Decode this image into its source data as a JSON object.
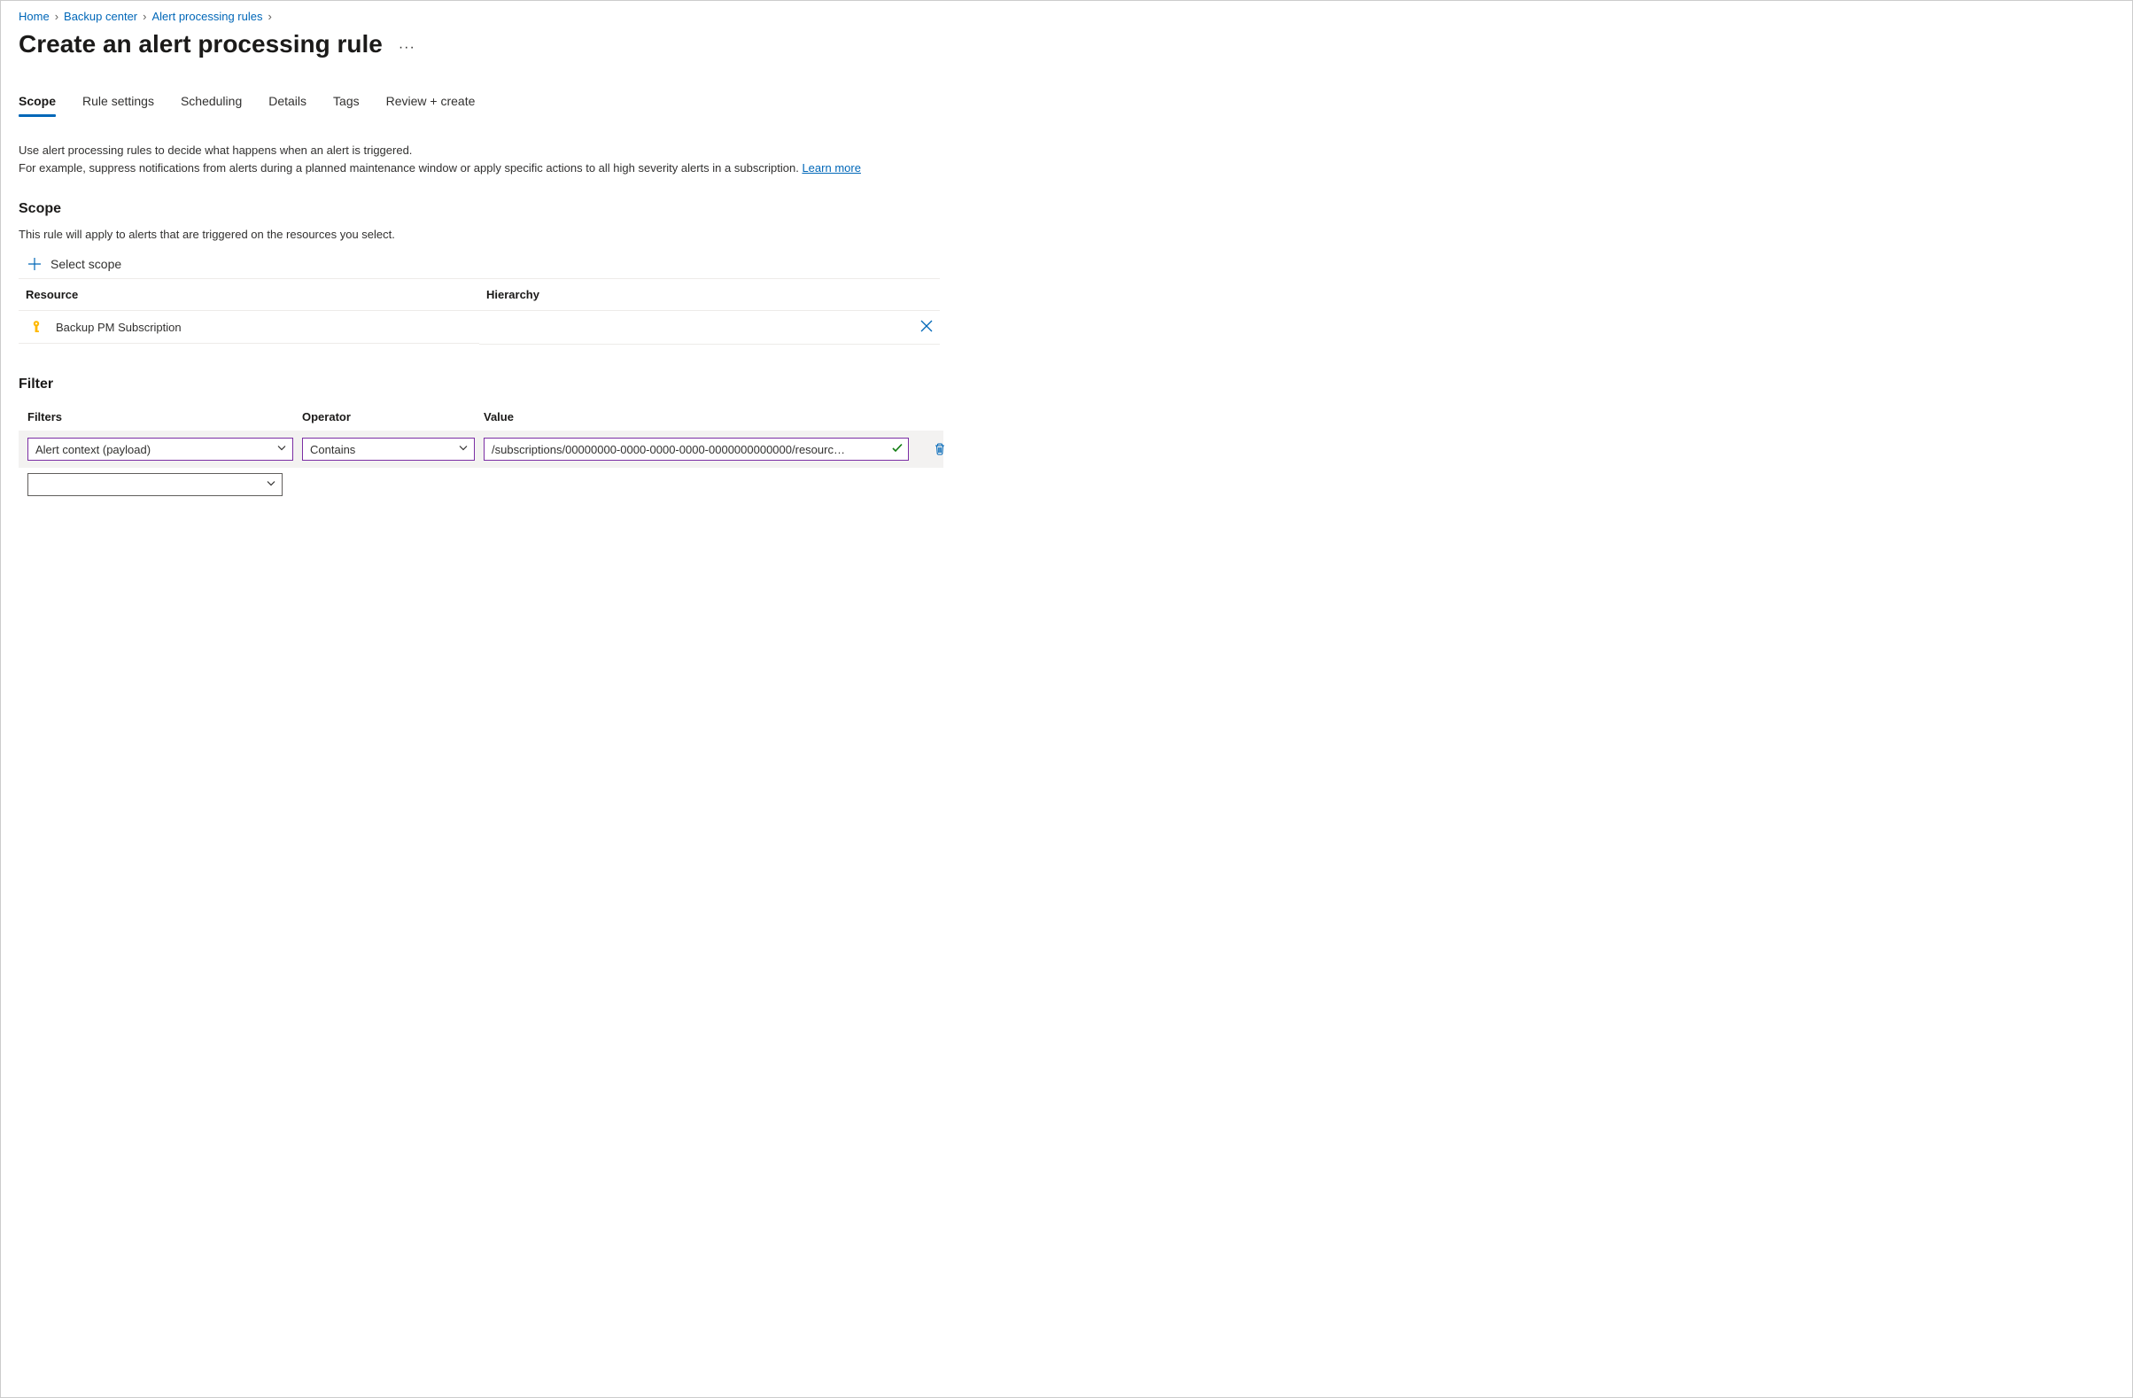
{
  "breadcrumb": {
    "home": "Home",
    "backup_center": "Backup center",
    "alert_rules": "Alert processing rules"
  },
  "title": "Create an alert processing rule",
  "tabs": {
    "scope": "Scope",
    "rule_settings": "Rule settings",
    "scheduling": "Scheduling",
    "details": "Details",
    "tags": "Tags",
    "review": "Review + create"
  },
  "intro": {
    "line1": "Use alert processing rules to decide what happens when an alert is triggered.",
    "line2a": "For example, suppress notifications from alerts during a planned maintenance window or apply specific actions to all high severity alerts in a subscription. ",
    "learn_more": "Learn more"
  },
  "scope": {
    "heading": "Scope",
    "sub": "This rule will apply to alerts that are triggered on the resources you select.",
    "select_scope": "Select scope",
    "col_resource": "Resource",
    "col_hierarchy": "Hierarchy",
    "row_resource": "Backup PM Subscription"
  },
  "filter": {
    "heading": "Filter",
    "col_filters": "Filters",
    "col_operator": "Operator",
    "col_value": "Value",
    "filters_value": "Alert context (payload)",
    "operator_value": "Contains",
    "value_value": "/subscriptions/00000000-0000-0000-0000-0000000000000/resourc…"
  }
}
